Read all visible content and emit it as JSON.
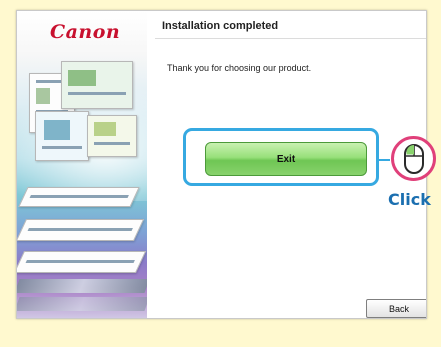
{
  "window": {
    "brand": "Canon",
    "title": "Installation completed",
    "message": "Thank you for choosing our product."
  },
  "buttons": {
    "exit_label": "Exit",
    "back_label": "Back"
  },
  "callout": {
    "click_label": "Click"
  },
  "colors": {
    "page_background": "#fff9cf",
    "highlight": "#36a9e1",
    "exit_button": "#88d26c",
    "mouse_circle": "#e0407a",
    "click_text": "#1b6fb0",
    "brand": "#c8102e"
  },
  "icons": {
    "mouse": "mouse-icon"
  }
}
